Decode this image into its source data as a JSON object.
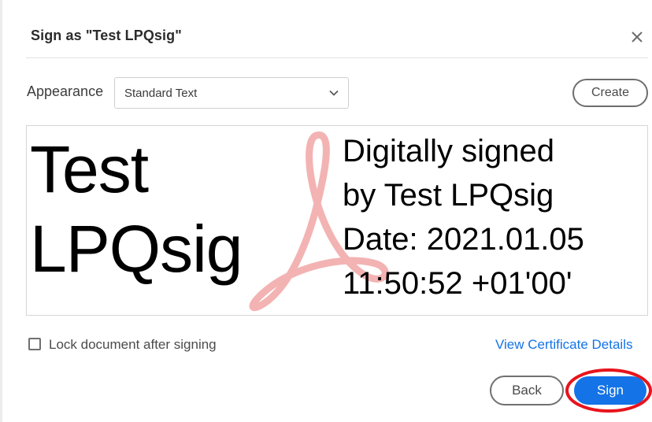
{
  "dialog": {
    "title": "Sign as \"Test LPQsig\"",
    "close_icon": "close-icon"
  },
  "appearance": {
    "label": "Appearance",
    "selected": "Standard Text",
    "chevron_icon": "chevron-down-icon",
    "create_label": "Create"
  },
  "preview": {
    "name_text": "Test\nLPQsig",
    "details_text": "Digitally signed\nby Test LPQsig\nDate: 2021.01.05\n11:50:52 +01'00'",
    "watermark_icon": "acrobat-logo-icon",
    "watermark_color": "#f3b3b3"
  },
  "options": {
    "lock_label": "Lock document after signing",
    "lock_checked": false,
    "certificate_link": "View Certificate Details"
  },
  "footer": {
    "back_label": "Back",
    "sign_label": "Sign",
    "sign_highlight_color": "#e8141c"
  },
  "colors": {
    "accent": "#1473e6",
    "text": "#2c2c2c",
    "border": "#cfcfcf"
  }
}
